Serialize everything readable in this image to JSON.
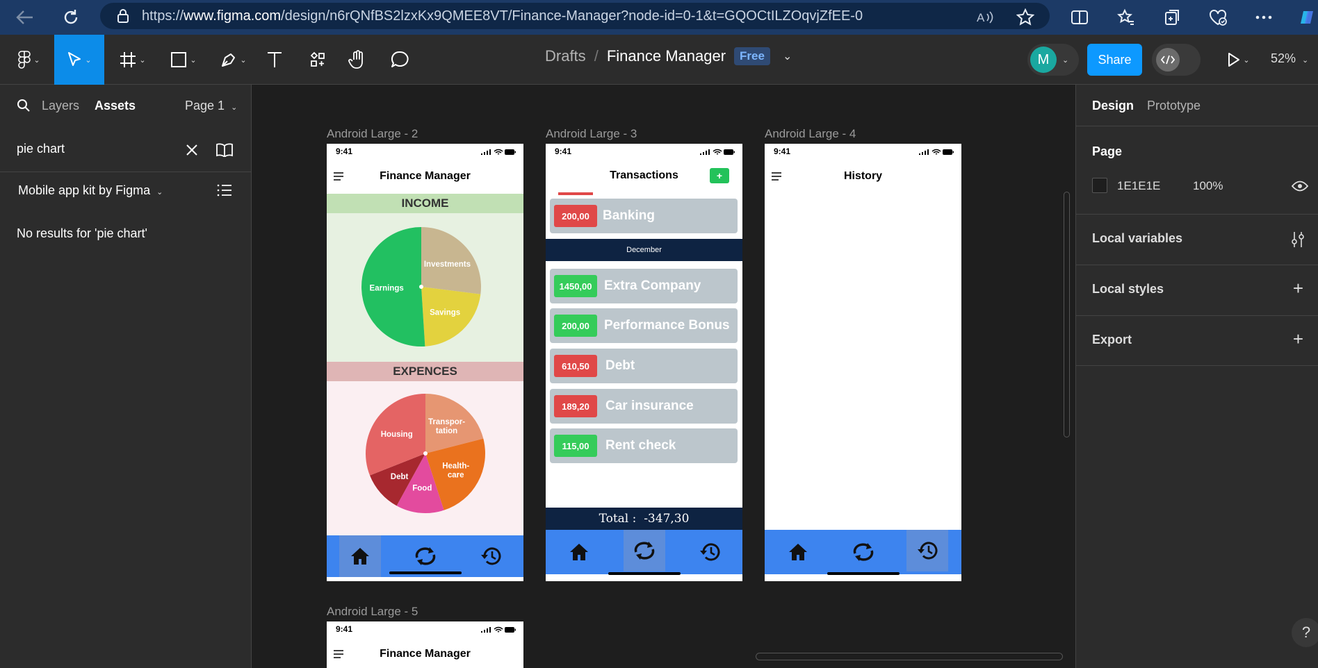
{
  "browser": {
    "url_prefix": "https://",
    "url_host": "www.figma.com",
    "url_rest": "/design/n6rQNfBS2lzxKx9QMEE8VT/Finance-Manager?node-id=0-1&t=GQOCtILZOqvjZfEE-0"
  },
  "toolbar": {
    "breadcrumb_parent": "Drafts",
    "breadcrumb_sep": "/",
    "file_name": "Finance Manager",
    "plan_badge": "Free",
    "avatar_initial": "M",
    "share_label": "Share",
    "zoom": "52%"
  },
  "left_panel": {
    "tabs": [
      "Layers",
      "Assets"
    ],
    "page_selector": "Page 1",
    "search_value": "pie chart",
    "library": "Mobile app kit by Figma",
    "empty_message": "No results for 'pie chart'"
  },
  "right_panel": {
    "tabs": [
      "Design",
      "Prototype"
    ],
    "page_heading": "Page",
    "bg_color_hex": "1E1E1E",
    "bg_opacity": "100%",
    "sections": [
      "Local variables",
      "Local styles",
      "Export"
    ]
  },
  "canvas": {
    "frames": [
      {
        "label": "Android Large - 2",
        "time": "9:41",
        "title": "Finance Manager",
        "income_heading": "INCOME",
        "expense_heading": "EXPENCES"
      },
      {
        "label": "Android Large - 3",
        "time": "9:41",
        "title": "Transactions",
        "add_label": "+",
        "month": "December",
        "total_label": "Total :",
        "total_value": "-347,30",
        "transactions_top": [
          {
            "amount": "200,00",
            "name": "Banking",
            "type": "neg"
          }
        ],
        "transactions": [
          {
            "amount": "1450,00",
            "name": "Extra Company",
            "type": "pos"
          },
          {
            "amount": "200,00",
            "name": "Performance Bonus",
            "type": "pos"
          },
          {
            "amount": "610,50",
            "name": "Debt",
            "type": "neg"
          },
          {
            "amount": "189,20",
            "name": "Car insurance",
            "type": "neg"
          },
          {
            "amount": "115,00",
            "name": "Rent check",
            "type": "pos"
          }
        ]
      },
      {
        "label": "Android Large - 4",
        "time": "9:41",
        "title": "History"
      },
      {
        "label": "Android Large - 5",
        "time": "9:41",
        "title": "Finance Manager"
      }
    ]
  },
  "chart_data": [
    {
      "type": "pie",
      "title": "INCOME",
      "labels": [
        "Investments",
        "Savings",
        "Earnings"
      ],
      "values": [
        27,
        22,
        51
      ],
      "colors": [
        "#c8b690",
        "#e3d23e",
        "#22c061"
      ]
    },
    {
      "type": "pie",
      "title": "EXPENCES",
      "labels": [
        "Transpor-tation",
        "Health-care",
        "Food",
        "Debt",
        "Housing"
      ],
      "label_lines": [
        [
          "Transpor-",
          "tation"
        ],
        [
          "Health-",
          "care"
        ],
        [
          "Food"
        ],
        [
          "Debt"
        ],
        [
          "Housing"
        ]
      ],
      "values": [
        21,
        24,
        13,
        11,
        31
      ],
      "colors": [
        "#e69672",
        "#ea721e",
        "#e34b9e",
        "#a7282f",
        "#e46464"
      ]
    }
  ],
  "help_label": "?"
}
